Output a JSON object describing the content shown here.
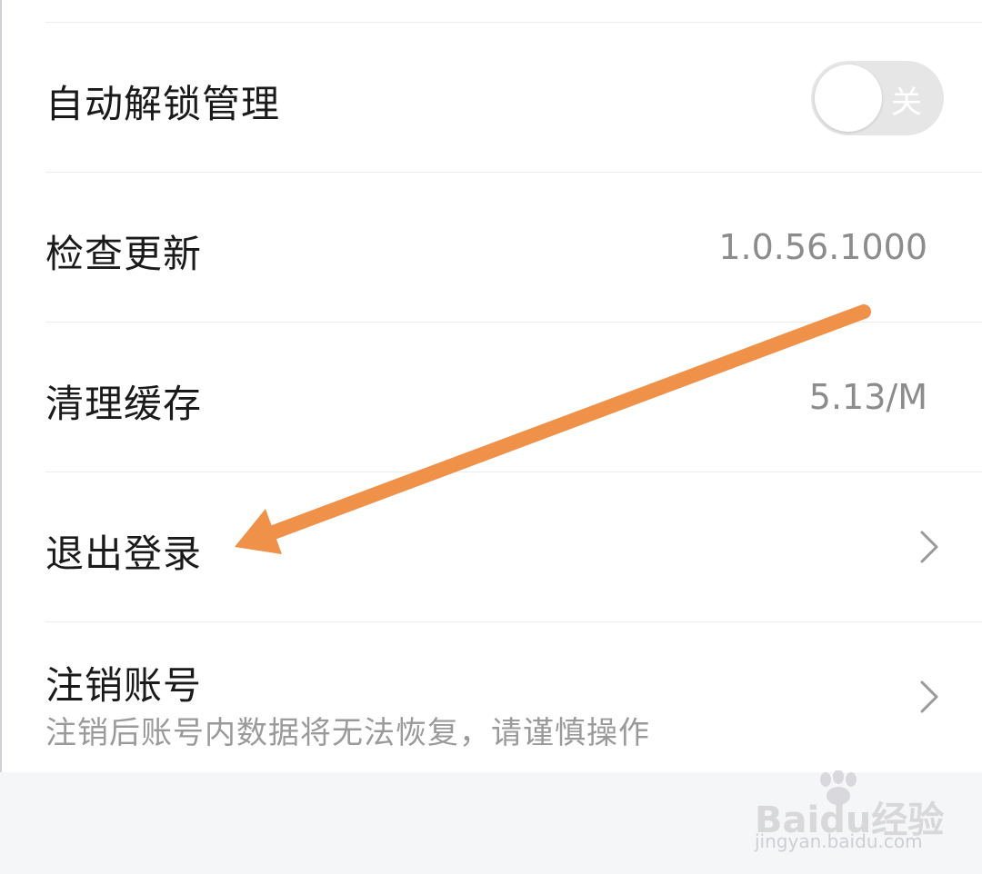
{
  "settings": {
    "auto_unlock": {
      "label": "自动解锁管理",
      "toggle_text": "关",
      "enabled": false
    },
    "check_update": {
      "label": "检查更新",
      "value": "1.0.56.1000"
    },
    "clear_cache": {
      "label": "清理缓存",
      "value": "5.13/M"
    },
    "logout": {
      "label": "退出登录"
    },
    "delete_account": {
      "label": "注销账号",
      "subtitle": "注销后账号内数据将无法恢复，请谨慎操作"
    }
  },
  "icons": {
    "row_chevron": "chevron-right-icon",
    "annotation_arrow": "arrow-icon",
    "watermark_paw": "paw-icon"
  },
  "colors": {
    "annotation_arrow": "#f0914a",
    "toggle_off_track": "#e6e6e6",
    "secondary_text": "#8c8c8c"
  },
  "watermark": {
    "brand": "Baidu经验",
    "url": "jingyan.baidu.com"
  }
}
